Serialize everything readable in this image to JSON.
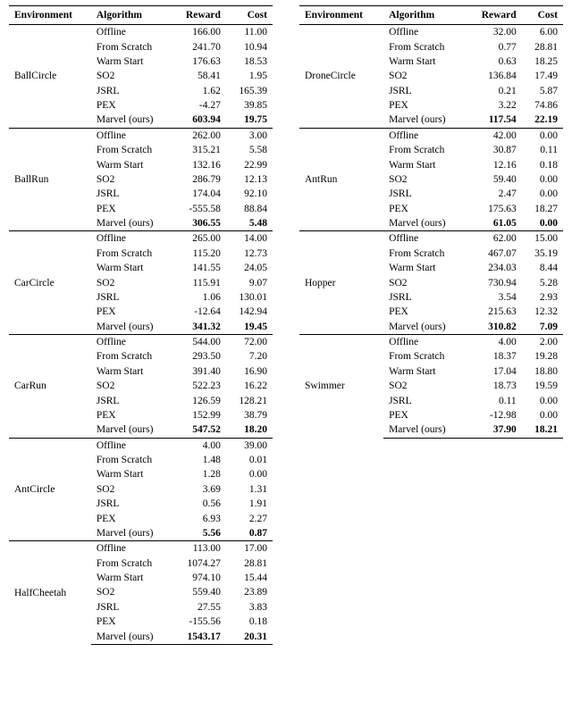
{
  "headers": {
    "env": "Environment",
    "algo": "Algorithm",
    "reward": "Reward",
    "cost": "Cost"
  },
  "algos": [
    "Offline",
    "From Scratch",
    "Warm Start",
    "SO2",
    "JSRL",
    "PEX",
    "Marvel (ours)"
  ],
  "left": [
    {
      "env": "BallCircle",
      "rows": [
        {
          "r": "166.00",
          "c": "11.00"
        },
        {
          "r": "241.70",
          "c": "10.94"
        },
        {
          "r": "176.63",
          "c": "18.53"
        },
        {
          "r": "58.41",
          "c": "1.95"
        },
        {
          "r": "1.62",
          "c": "165.39"
        },
        {
          "r": "-4.27",
          "c": "39.85"
        },
        {
          "r": "603.94",
          "c": "19.75",
          "bold": true
        }
      ]
    },
    {
      "env": "BallRun",
      "rows": [
        {
          "r": "262.00",
          "c": "3.00"
        },
        {
          "r": "315.21",
          "c": "5.58"
        },
        {
          "r": "132.16",
          "c": "22.99"
        },
        {
          "r": "286.79",
          "c": "12.13"
        },
        {
          "r": "174.04",
          "c": "92.10"
        },
        {
          "r": "-555.58",
          "c": "88.84"
        },
        {
          "r": "306.55",
          "c": "5.48",
          "bold": true
        }
      ]
    },
    {
      "env": "CarCircle",
      "rows": [
        {
          "r": "265.00",
          "c": "14.00"
        },
        {
          "r": "115.20",
          "c": "12.73"
        },
        {
          "r": "141.55",
          "c": "24.05"
        },
        {
          "r": "115.91",
          "c": "9.07"
        },
        {
          "r": "1.06",
          "c": "130.01"
        },
        {
          "r": "-12.64",
          "c": "142.94"
        },
        {
          "r": "341.32",
          "c": "19.45",
          "bold": true
        }
      ]
    },
    {
      "env": "CarRun",
      "rows": [
        {
          "r": "544.00",
          "c": "72.00"
        },
        {
          "r": "293.50",
          "c": "7.20"
        },
        {
          "r": "391.40",
          "c": "16.90"
        },
        {
          "r": "522.23",
          "c": "16.22"
        },
        {
          "r": "126.59",
          "c": "128.21"
        },
        {
          "r": "152.99",
          "c": "38.79"
        },
        {
          "r": "547.52",
          "c": "18.20",
          "bold": true
        }
      ]
    },
    {
      "env": "AntCircle",
      "rows": [
        {
          "r": "4.00",
          "c": "39.00"
        },
        {
          "r": "1.48",
          "c": "0.01"
        },
        {
          "r": "1.28",
          "c": "0.00"
        },
        {
          "r": "3.69",
          "c": "1.31"
        },
        {
          "r": "0.56",
          "c": "1.91"
        },
        {
          "r": "6.93",
          "c": "2.27"
        },
        {
          "r": "5.56",
          "c": "0.87",
          "bold": true
        }
      ]
    },
    {
      "env": "HalfCheetah",
      "rows": [
        {
          "r": "113.00",
          "c": "17.00"
        },
        {
          "r": "1074.27",
          "c": "28.81"
        },
        {
          "r": "974.10",
          "c": "15.44"
        },
        {
          "r": "559.40",
          "c": "23.89"
        },
        {
          "r": "27.55",
          "c": "3.83"
        },
        {
          "r": "-155.56",
          "c": "0.18"
        },
        {
          "r": "1543.17",
          "c": "20.31",
          "bold": true
        }
      ]
    }
  ],
  "right": [
    {
      "env": "DroneCircle",
      "rows": [
        {
          "r": "32.00",
          "c": "6.00"
        },
        {
          "r": "0.77",
          "c": "28.81"
        },
        {
          "r": "0.63",
          "c": "18.25"
        },
        {
          "r": "136.84",
          "c": "17.49"
        },
        {
          "r": "0.21",
          "c": "5.87"
        },
        {
          "r": "3.22",
          "c": "74.86"
        },
        {
          "r": "117.54",
          "c": "22.19",
          "bold": true
        }
      ]
    },
    {
      "env": "AntRun",
      "rows": [
        {
          "r": "42.00",
          "c": "0.00"
        },
        {
          "r": "30.87",
          "c": "0.11"
        },
        {
          "r": "12.16",
          "c": "0.18"
        },
        {
          "r": "59.40",
          "c": "0.00"
        },
        {
          "r": "2.47",
          "c": "0.00"
        },
        {
          "r": "175.63",
          "c": "18.27"
        },
        {
          "r": "61.05",
          "c": "0.00",
          "bold": true
        }
      ]
    },
    {
      "env": "Hopper",
      "rows": [
        {
          "r": "62.00",
          "c": "15.00"
        },
        {
          "r": "467.07",
          "c": "35.19"
        },
        {
          "r": "234.03",
          "c": "8.44"
        },
        {
          "r": "730.94",
          "c": "5.28"
        },
        {
          "r": "3.54",
          "c": "2.93"
        },
        {
          "r": "215.63",
          "c": "12.32"
        },
        {
          "r": "310.82",
          "c": "7.09",
          "bold": true
        }
      ]
    },
    {
      "env": "Swimmer",
      "rows": [
        {
          "r": "4.00",
          "c": "2.00"
        },
        {
          "r": "18.37",
          "c": "19.28"
        },
        {
          "r": "17.04",
          "c": "18.80"
        },
        {
          "r": "18.73",
          "c": "19.59"
        },
        {
          "r": "0.11",
          "c": "0.00"
        },
        {
          "r": "-12.98",
          "c": "0.00"
        },
        {
          "r": "37.90",
          "c": "18.21",
          "bold": true
        }
      ]
    }
  ],
  "chart_data": {
    "type": "table",
    "title": "Algorithm performance (Reward and Cost) across environments",
    "columns": [
      "Environment",
      "Algorithm",
      "Reward",
      "Cost"
    ],
    "algorithms": [
      "Offline",
      "From Scratch",
      "Warm Start",
      "SO2",
      "JSRL",
      "PEX",
      "Marvel (ours)"
    ],
    "environments": {
      "BallCircle": {
        "Reward": [
          166.0,
          241.7,
          176.63,
          58.41,
          1.62,
          -4.27,
          603.94
        ],
        "Cost": [
          11.0,
          10.94,
          18.53,
          1.95,
          165.39,
          39.85,
          19.75
        ]
      },
      "BallRun": {
        "Reward": [
          262.0,
          315.21,
          132.16,
          286.79,
          174.04,
          -555.58,
          306.55
        ],
        "Cost": [
          3.0,
          5.58,
          22.99,
          12.13,
          92.1,
          88.84,
          5.48
        ]
      },
      "CarCircle": {
        "Reward": [
          265.0,
          115.2,
          141.55,
          115.91,
          1.06,
          -12.64,
          341.32
        ],
        "Cost": [
          14.0,
          12.73,
          24.05,
          9.07,
          130.01,
          142.94,
          19.45
        ]
      },
      "CarRun": {
        "Reward": [
          544.0,
          293.5,
          391.4,
          522.23,
          126.59,
          152.99,
          547.52
        ],
        "Cost": [
          72.0,
          7.2,
          16.9,
          16.22,
          128.21,
          38.79,
          18.2
        ]
      },
      "AntCircle": {
        "Reward": [
          4.0,
          1.48,
          1.28,
          3.69,
          0.56,
          6.93,
          5.56
        ],
        "Cost": [
          39.0,
          0.01,
          0.0,
          1.31,
          1.91,
          2.27,
          0.87
        ]
      },
      "HalfCheetah": {
        "Reward": [
          113.0,
          1074.27,
          974.1,
          559.4,
          27.55,
          -155.56,
          1543.17
        ],
        "Cost": [
          17.0,
          28.81,
          15.44,
          23.89,
          3.83,
          0.18,
          20.31
        ]
      },
      "DroneCircle": {
        "Reward": [
          32.0,
          0.77,
          0.63,
          136.84,
          0.21,
          3.22,
          117.54
        ],
        "Cost": [
          6.0,
          28.81,
          18.25,
          17.49,
          5.87,
          74.86,
          22.19
        ]
      },
      "AntRun": {
        "Reward": [
          42.0,
          30.87,
          12.16,
          59.4,
          2.47,
          175.63,
          61.05
        ],
        "Cost": [
          0.0,
          0.11,
          0.18,
          0.0,
          0.0,
          18.27,
          0.0
        ]
      },
      "Hopper": {
        "Reward": [
          62.0,
          467.07,
          234.03,
          730.94,
          3.54,
          215.63,
          310.82
        ],
        "Cost": [
          15.0,
          35.19,
          8.44,
          5.28,
          2.93,
          12.32,
          7.09
        ]
      },
      "Swimmer": {
        "Reward": [
          4.0,
          18.37,
          17.04,
          18.73,
          0.11,
          -12.98,
          37.9
        ],
        "Cost": [
          2.0,
          19.28,
          18.8,
          19.59,
          0.0,
          0.0,
          18.21
        ]
      }
    }
  }
}
